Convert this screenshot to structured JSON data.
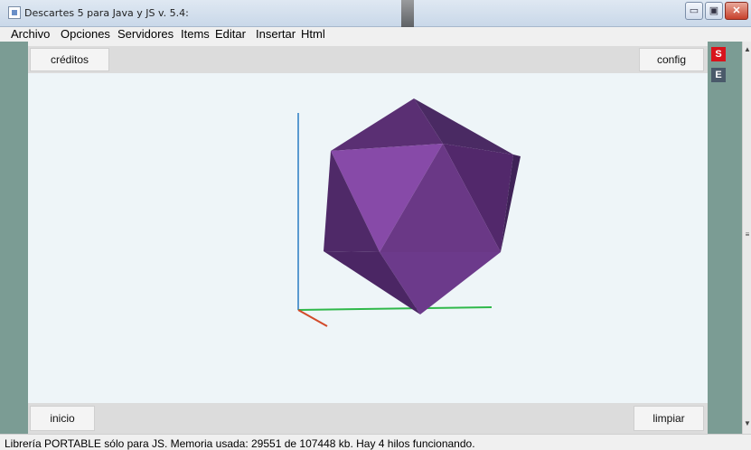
{
  "window": {
    "title": "Descartes 5 para Java y JS v. 5.4:",
    "controls": {
      "minimize": "▭",
      "maximize": "▣",
      "close": "✕"
    }
  },
  "menu": [
    "Archivo",
    "Opciones",
    "Servidores",
    "Items",
    "Editar",
    "Insertar",
    "Html"
  ],
  "buttons": {
    "creditos": "créditos",
    "config": "config",
    "inicio": "inicio",
    "limpiar": "limpiar"
  },
  "side_squares": {
    "s_label": "S",
    "e_label": "E"
  },
  "scene": {
    "shape": "icosahedron",
    "axes": [
      "x-red",
      "y-green",
      "z-blue"
    ]
  },
  "colors": {
    "frame": "#7b9c94",
    "s_square": "#d8141c",
    "e_square": "#4a5a6a",
    "shape_main": "#7a3e94"
  },
  "status": "Librería PORTABLE sólo para JS. Memoria usada: 29551 de 107448 kb. Hay 4 hilos funcionando."
}
